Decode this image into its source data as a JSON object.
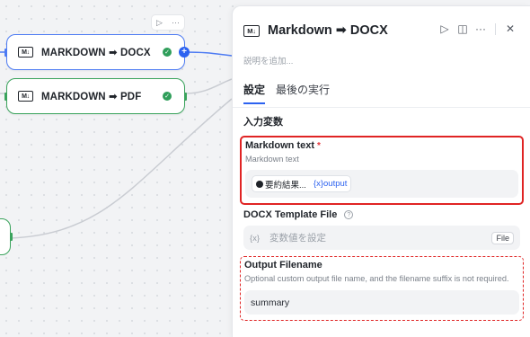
{
  "canvas": {
    "node_toolbar": {
      "run_icon": "▷",
      "more_icon": "···"
    },
    "nodes": [
      {
        "label": "MARKDOWN ➡ DOCX",
        "icon_text": "M↓"
      },
      {
        "label": "MARKDOWN ➡ PDF",
        "icon_text": "M↓"
      }
    ],
    "colors": {
      "selected": "#4d7bf3",
      "success": "#3aa35c",
      "edge": "#c9ccd2"
    }
  },
  "panel": {
    "icon_text": "M↓",
    "title": "Markdown ➡ DOCX",
    "actions": {
      "run": "▷",
      "split": "◫",
      "more": "···",
      "close": "✕"
    },
    "description_placeholder": "説明を追加...",
    "tabs": [
      {
        "label": "設定",
        "active": true
      },
      {
        "label": "最後の実行",
        "active": false
      }
    ],
    "section_title": "入力変数",
    "fields": {
      "markdown_text": {
        "label": "Markdown text",
        "required_mark": "*",
        "hint": "Markdown text",
        "chip_text": "要約結果...",
        "chip_var": "{x}output"
      },
      "docx_template": {
        "label": "DOCX Template File",
        "help": "?",
        "var_prefix": "{x}",
        "placeholder": "変数値を設定",
        "badge": "File"
      },
      "output_filename": {
        "label": "Output Filename",
        "hint": "Optional custom output file name, and the filename suffix is not required.",
        "value": "summary"
      }
    }
  }
}
